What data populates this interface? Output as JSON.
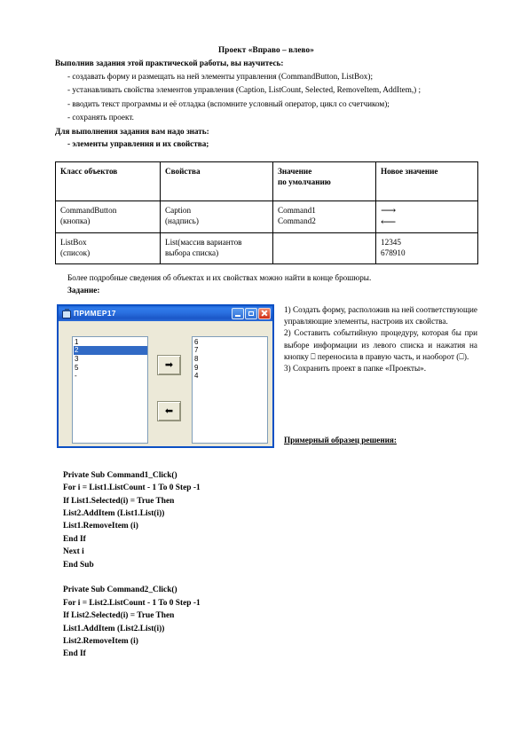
{
  "document": {
    "title": "Проект «Вправо – влево»",
    "lead": "Выполнив задания этой практической работы, вы научитесь:",
    "bullets": [
      "-  создавать форму и размещать   на ней элементы  управления (CommandButton, ListBox);",
      "-  устанавливать свойства   элементов управления (Caption, ListCount, Selected, RemoveItem, AddItem,) ;",
      "- вводить текст   программы и её отладка (вспомните условный оператор, цикл со счетчиком);",
      "- сохранять проект."
    ],
    "subhead": "Для выполнения задания вам надо знать:",
    "knowledge_item": "-    элементы  управления и их свойства;",
    "note": "Более подробные сведения об объектах и их свойствах можно найти в конце брошюры.",
    "task_label": "Задание:"
  },
  "table": {
    "headers": [
      "Класс объектов",
      "Свойства",
      {
        "line1": "Значение",
        "line2": "по умолчанию"
      },
      "Новое значение"
    ],
    "rows": [
      {
        "class": {
          "line1": "CommandButton",
          "line2": "(кнопка)"
        },
        "property": {
          "line1": "Caption",
          "line2": "(надпись)"
        },
        "default": {
          "line1": "Command1",
          "line2": "Command2"
        },
        "newvalue": {
          "line1": "⟶",
          "line2": "⟵"
        }
      },
      {
        "class": {
          "line1": "ListBox",
          "line2": "(список)"
        },
        "property": {
          "line1": "List(массив     вариантов",
          "line2": "выбора списка)"
        },
        "default": {
          "line1": "",
          "line2": ""
        },
        "newvalue": {
          "line1": "12345",
          "line2": "678910"
        }
      }
    ]
  },
  "vbform": {
    "title": "ПРИМЕР17",
    "buttons": {
      "minimize": "minimize",
      "maximize": "maximize",
      "close": "close"
    },
    "list_left": {
      "items": [
        "1",
        "2",
        "3",
        "5",
        "-"
      ],
      "selected_index": 1
    },
    "list_right": {
      "items": [
        "6",
        "7",
        "8",
        "9",
        "4"
      ]
    },
    "command1_glyph": "➡",
    "command2_glyph": "⬅"
  },
  "instructions": {
    "items": [
      "1) Создать форму, расположив на ней соответствующие управляющие элементы, настроив их свойства.",
      "2) Составить событийную процедуру, которая бы при выборе информации из левого списка и нажатия на кнопку  ⎕  переносила в правую часть, и наоборот (⎕).",
      "3) Сохранить проект в папке «Проекты»."
    ],
    "sample_label": "Примерный образец решения:"
  },
  "code": {
    "lines": [
      "Private Sub Command1_Click()",
      "For i = List1.ListCount - 1 To 0 Step -1",
      "If List1.Selected(i) = True Then",
      "List2.AddItem (List1.List(i))",
      "List1.RemoveItem (i)",
      "End If",
      "Next i",
      "End Sub",
      "",
      "Private Sub Command2_Click()",
      "For i = List2.ListCount - 1 To 0 Step -1",
      "If List2.Selected(i) = True Then",
      "List1.AddItem (List2.List(i))",
      "List2.RemoveItem (i)",
      "End If"
    ]
  },
  "colors": {
    "titlebar_blue": "#1f65d6",
    "selection_blue": "#316ac5",
    "form_face": "#ece9d8",
    "form_border": "#0b50c4"
  }
}
